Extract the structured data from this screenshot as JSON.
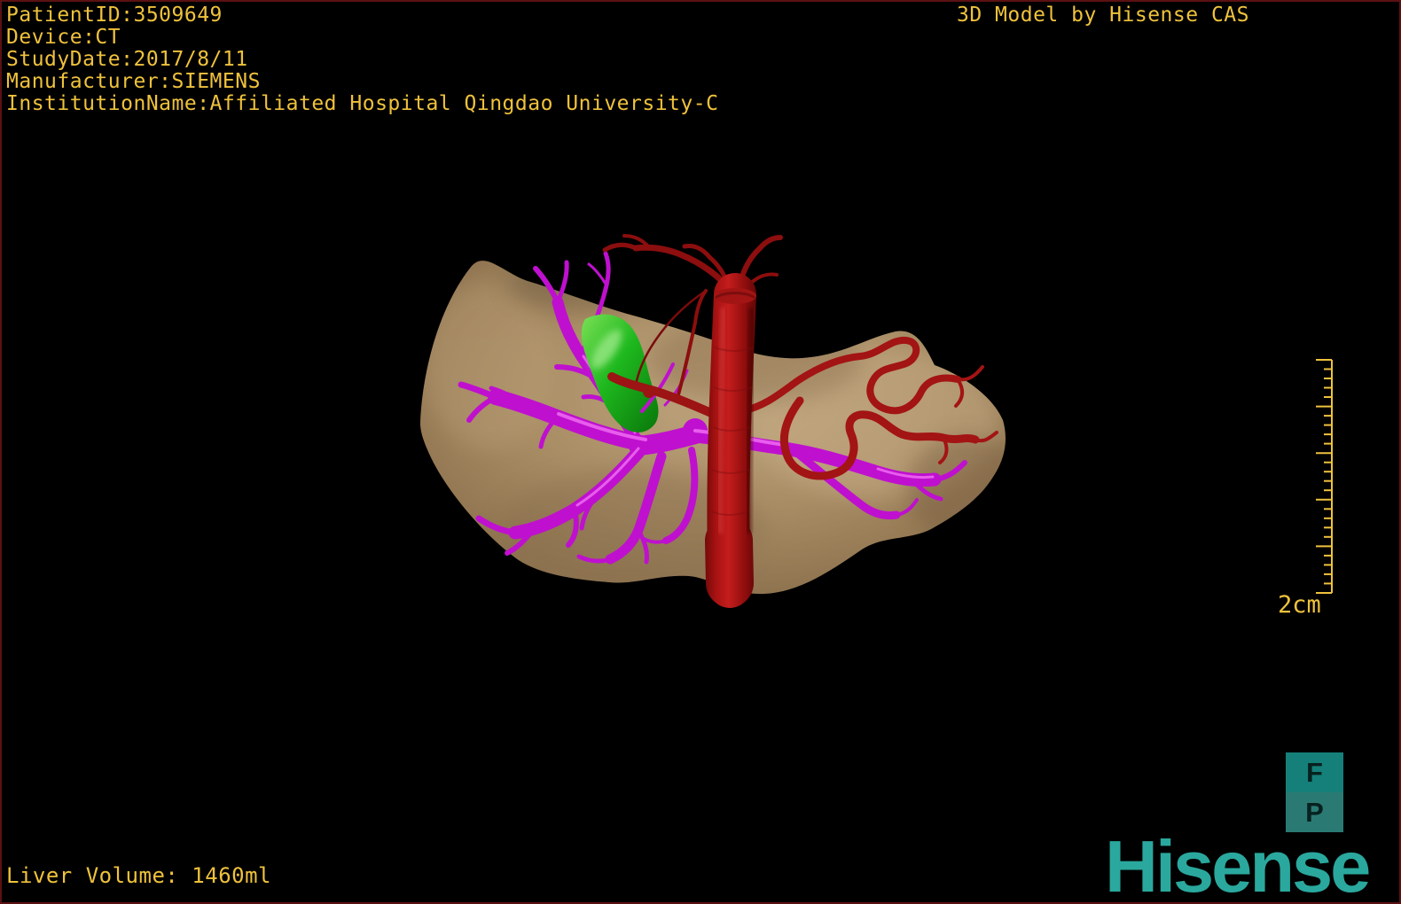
{
  "overlay": {
    "patient_lines": [
      "PatientID:3509649",
      "Device:CT",
      "StudyDate:2017/8/11",
      "Manufacturer:SIEMENS",
      "InstitutionName:Affiliated Hospital Qingdao University-C"
    ],
    "watermark": "3D Model by Hisense CAS",
    "liver_volume": "Liver Volume: 1460ml"
  },
  "scale_bar": {
    "label": "2cm"
  },
  "view_buttons": {
    "front_label": "F",
    "posterior_label": "P"
  },
  "brand": {
    "logo_text": "Hisense"
  },
  "colors": {
    "overlay_text": "#EFC23C",
    "frame_border": "#5C1112",
    "brand_teal": "#2AA89D",
    "button_front_teal": "#15807A",
    "button_posterior_teal": "#2A7A73",
    "liver_tan": "#A88C64",
    "portal_vein_magenta": "#BF10CF",
    "gallbladder_green": "#1EB81E",
    "artery_red": "#A31414"
  },
  "model_structures": [
    "liver",
    "portal-vein-tree",
    "gallbladder",
    "aorta",
    "hepatic-artery"
  ]
}
